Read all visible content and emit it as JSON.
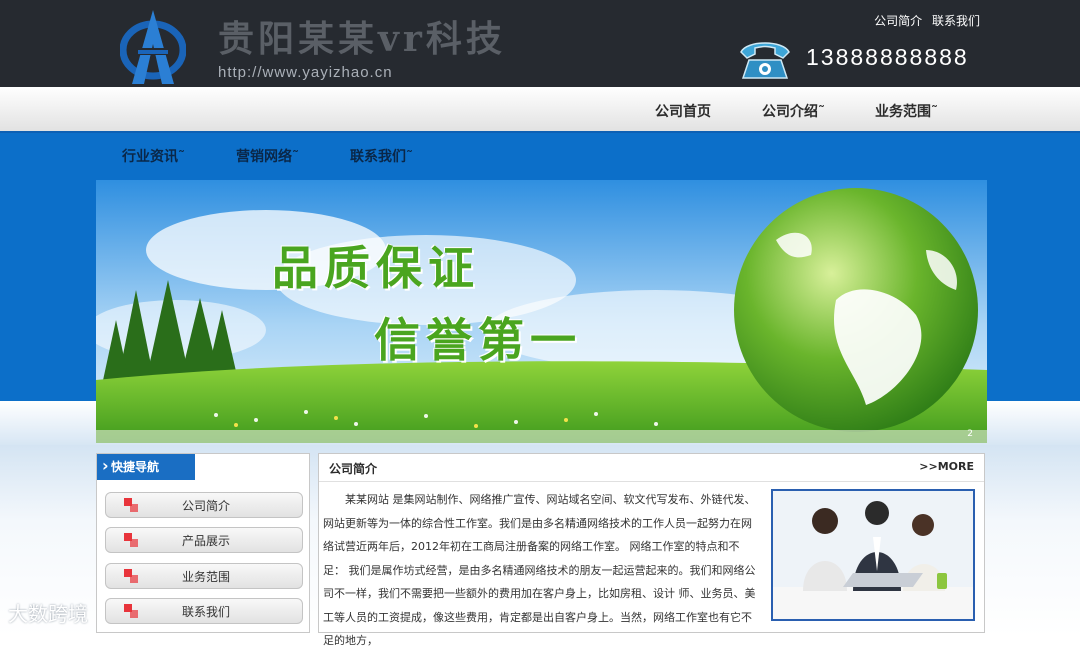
{
  "header": {
    "site_title": "贵阳某某vr科技",
    "site_url": "http://www.yayizhao.cn",
    "top_links": [
      "公司简介",
      "联系我们"
    ],
    "phone": "13888888888"
  },
  "nav_primary": [
    "公司首页",
    "公司介绍˜",
    "业务范围˜"
  ],
  "nav_secondary": [
    "行业资讯˜",
    "营销网络˜",
    "联系我们˜"
  ],
  "banner": {
    "slogan_1": "品质保证",
    "slogan_2": "信誉第一",
    "slide_number": "2"
  },
  "sidebar": {
    "title": "快捷导航",
    "items": [
      "公司简介",
      "产品展示",
      "业务范围",
      "联系我们"
    ]
  },
  "content": {
    "title": "公司简介",
    "more": ">>MORE",
    "paragraph": "某某网站 是集网站制作、网络推广宣传、网站域名空间、软文代写发布、外链代发、网站更新等为一体的综合性工作室。我们是由多名精通网络技术的工作人员一起努力在网络试营近两年后，2012年初在工商局注册备案的网络工作室。 网络工作室的特点和不足： 我们是属作坊式经营，是由多名精通网络技术的朋友一起运营起来的。我们和网络公司不一样，我们不需要把一些额外的费用加在客户身上，比如房租、设计 师、业务员、美工等人员的工资提成，像这些费用，肯定都是出自客户身上。当然，网络工作室也有它不足的地方，"
  },
  "watermark": "大数跨境",
  "colors": {
    "header_bg": "#262a30",
    "band_blue": "#0c6fc9",
    "accent_blue": "#1a6ec3",
    "slogan_green": "#4aa51f"
  }
}
